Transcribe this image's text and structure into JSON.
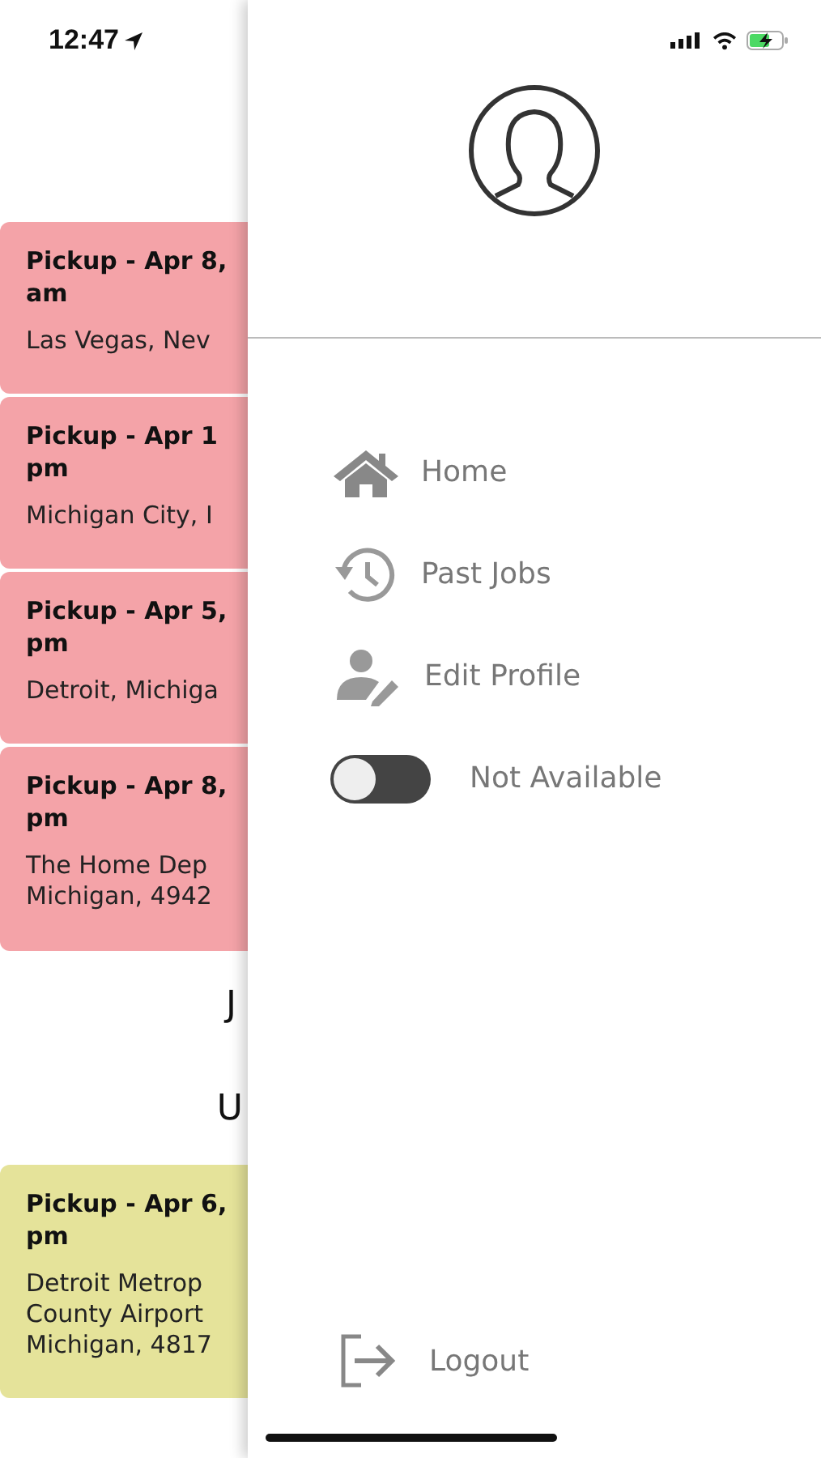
{
  "status_bar": {
    "time": "12:47"
  },
  "jobs": [
    {
      "title_lines": [
        "Pickup - Apr 8,",
        "am"
      ],
      "address_lines": [
        "Las Vegas, Nev"
      ],
      "color": "#f4a3a8"
    },
    {
      "title_lines": [
        "Pickup - Apr 1",
        "pm"
      ],
      "address_lines": [
        "Michigan City, I"
      ],
      "color": "#f4a3a8"
    },
    {
      "title_lines": [
        "Pickup - Apr 5,",
        "pm"
      ],
      "address_lines": [
        "Detroit, Michiga"
      ],
      "color": "#f4a3a8"
    },
    {
      "title_lines": [
        "Pickup - Apr 8,",
        "pm"
      ],
      "address_lines": [
        "The Home Dep",
        "Michigan, 4942"
      ],
      "color": "#f4a3a8"
    }
  ],
  "section_headings": [
    "J",
    "U"
  ],
  "upcoming_jobs": [
    {
      "title_lines": [
        "Pickup - Apr 6,",
        "pm"
      ],
      "address_lines": [
        "Detroit Metrop",
        "County Airport",
        "Michigan, 4817"
      ],
      "color": "#e5e39a"
    }
  ],
  "drawer": {
    "menu": [
      {
        "kind": "home",
        "label": "Home"
      },
      {
        "kind": "history",
        "label": "Past Jobs"
      },
      {
        "kind": "edit-profile",
        "label": "Edit Profile"
      }
    ],
    "availability": {
      "label": "Not Available",
      "on": false
    },
    "logout": {
      "label": "Logout"
    }
  }
}
